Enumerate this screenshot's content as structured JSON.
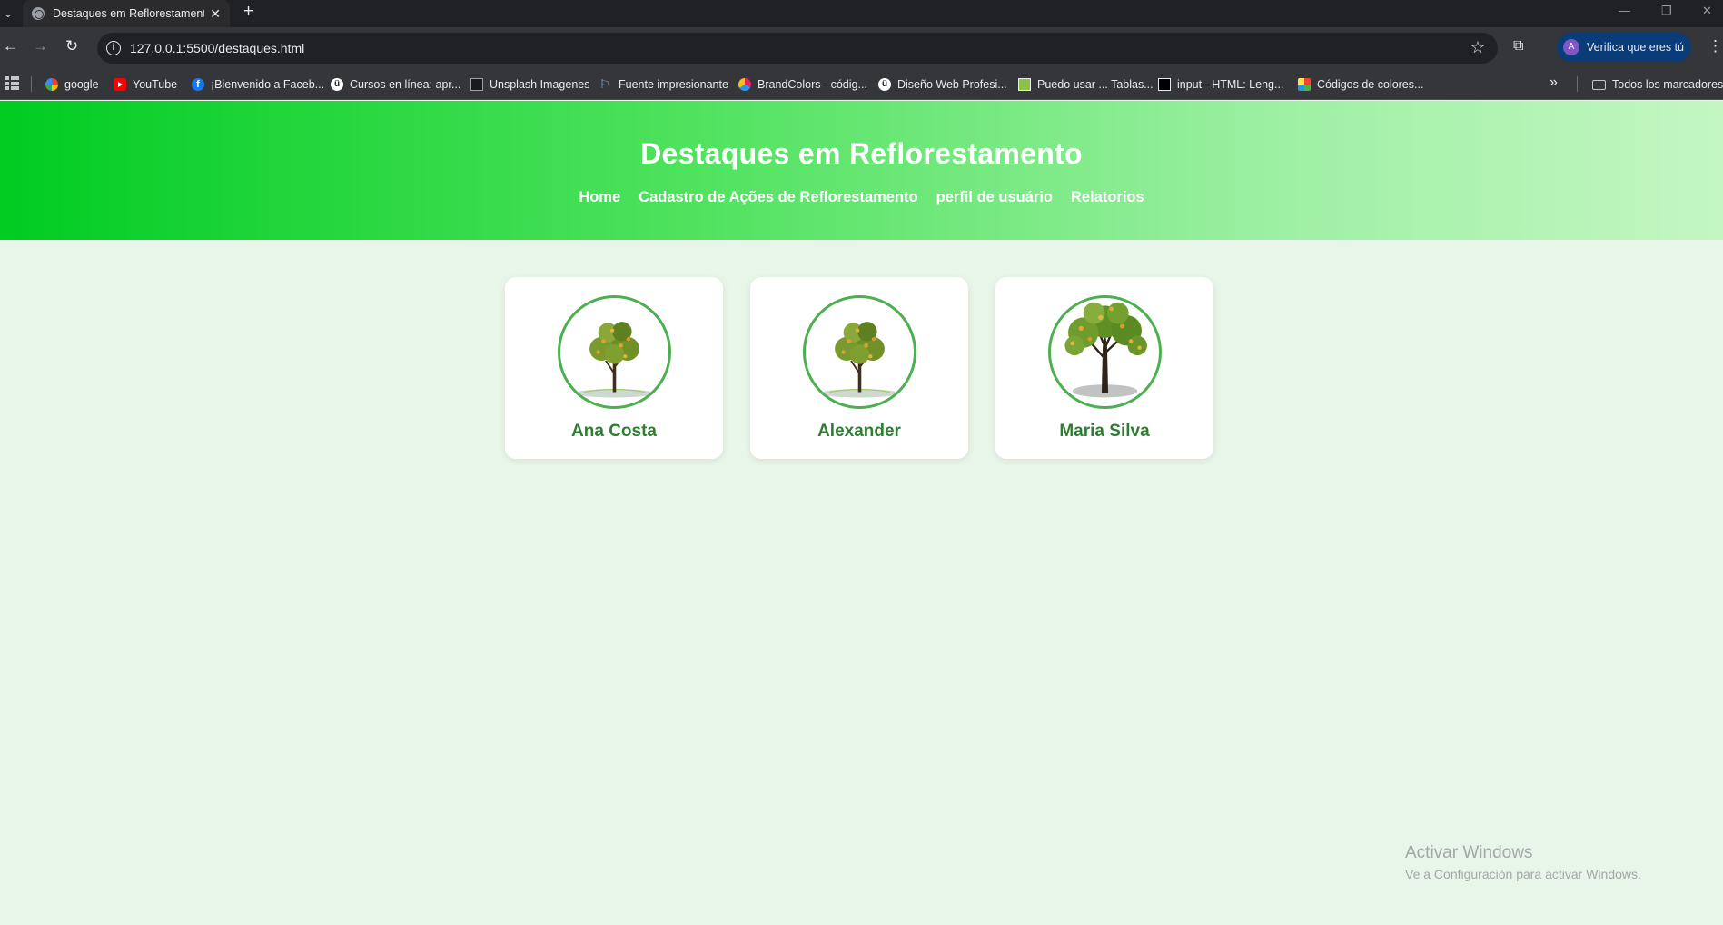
{
  "browser": {
    "tab_title": "Destaques em Reflorestamento",
    "tab_close": "✕",
    "new_tab": "+",
    "url": "127.0.0.1:5500/destaques.html",
    "profile_initial": "A",
    "profile_text": "Verifica que eres tú",
    "window_controls": [
      "—",
      "❐",
      "✕"
    ]
  },
  "bookmarks": [
    {
      "label": "google",
      "icon": "google-icon"
    },
    {
      "label": "YouTube",
      "icon": "youtube-icon"
    },
    {
      "label": "¡Bienvenido a Faceb...",
      "icon": "facebook-icon"
    },
    {
      "label": "Cursos en línea: apr...",
      "icon": "udemy-icon"
    },
    {
      "label": "Unsplash Imagenes",
      "icon": "unsplash-icon"
    },
    {
      "label": "Fuente impresionante",
      "icon": "flag-icon"
    },
    {
      "label": "BrandColors - códig...",
      "icon": "brandcolors-icon"
    },
    {
      "label": "Diseño Web Profesi...",
      "icon": "udemy-icon"
    },
    {
      "label": "Puedo usar ... Tablas...",
      "icon": "image-icon"
    },
    {
      "label": "input - HTML: Leng...",
      "icon": "mdn-icon"
    },
    {
      "label": "Códigos de colores...",
      "icon": "color-codes-icon"
    }
  ],
  "bookmarks_folder": "Todos los marcadores",
  "site": {
    "title": "Destaques em Reflorestamento",
    "nav": [
      "Home",
      "Cadastro de Ações de Reflorestamento",
      "perfil de usuário",
      "Relatorios"
    ],
    "accent_color": "#4caf50",
    "name_color": "#2e7d32"
  },
  "cards": [
    {
      "name": "Ana Costa",
      "image": "small-tree"
    },
    {
      "name": "Alexander",
      "image": "small-tree"
    },
    {
      "name": "Maria Silva",
      "image": "large-tree"
    }
  ],
  "watermark": {
    "title": "Activar Windows",
    "subtitle": "Ve a Configuración para activar Windows."
  }
}
